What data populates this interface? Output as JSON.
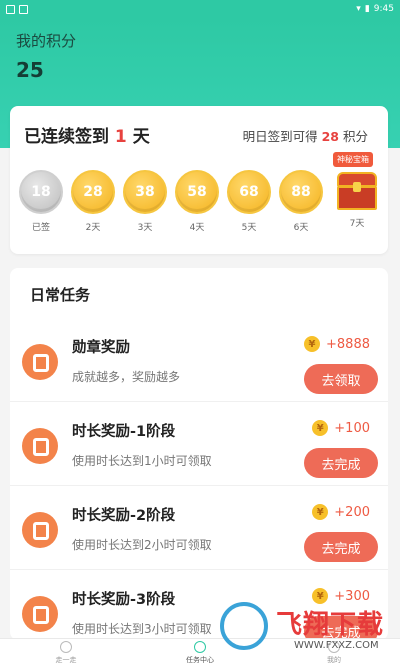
{
  "status_bar": {
    "time": "9:45"
  },
  "points": {
    "label": "我的积分",
    "value": "25"
  },
  "checkin": {
    "prefix": "已连续签到",
    "days": "1",
    "suffix": "天",
    "tip_prefix": "明日签到可得",
    "tip_points": "28",
    "tip_suffix": "积分",
    "mystery_badge": "神秘宝箱",
    "items": [
      {
        "value": "18",
        "label": "已签"
      },
      {
        "value": "28",
        "label": "2天"
      },
      {
        "value": "38",
        "label": "3天"
      },
      {
        "value": "58",
        "label": "4天"
      },
      {
        "value": "68",
        "label": "5天"
      },
      {
        "value": "88",
        "label": "6天"
      },
      {
        "value": "",
        "label": "7天"
      }
    ]
  },
  "tasks": {
    "title": "日常任务",
    "items": [
      {
        "name": "勋章奖励",
        "desc": "成就越多，奖励越多",
        "reward": "+8888",
        "button": "去领取"
      },
      {
        "name": "时长奖励-1阶段",
        "desc": "使用时长达到1小时可领取",
        "reward": "+100",
        "button": "去完成"
      },
      {
        "name": "时长奖励-2阶段",
        "desc": "使用时长达到2小时可领取",
        "reward": "+200",
        "button": "去完成"
      },
      {
        "name": "时长奖励-3阶段",
        "desc": "使用时长达到3小时可领取",
        "reward": "+300",
        "button": "去完成"
      }
    ]
  },
  "tabbar": {
    "items": [
      {
        "label": "走一走"
      },
      {
        "label": "任务中心"
      },
      {
        "label": "我的"
      }
    ]
  },
  "watermark": {
    "text": "飞翔下载",
    "url": "WWW.FXXZ.COM"
  },
  "colors": {
    "accent": "#2ec9a4",
    "button": "#ee6b57",
    "highlight": "#e7423f",
    "coin": "#f4b21d"
  }
}
